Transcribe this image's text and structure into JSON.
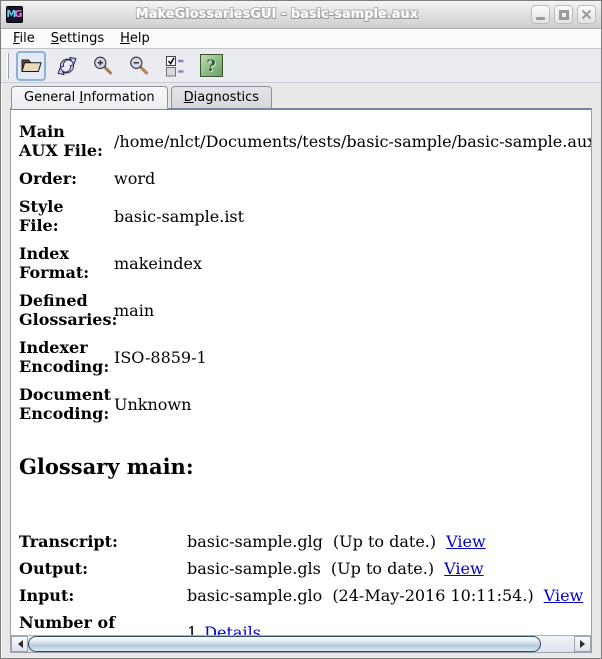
{
  "window": {
    "title": "MakeGlossariesGUI - basic-sample.aux",
    "icon_m": "M",
    "icon_g": "G"
  },
  "menu": {
    "items": [
      {
        "pre": "",
        "key": "F",
        "post": "ile"
      },
      {
        "pre": "",
        "key": "S",
        "post": "ettings"
      },
      {
        "pre": "",
        "key": "H",
        "post": "elp"
      }
    ]
  },
  "toolbar": {
    "icons": [
      "open-file-icon",
      "reload-icon",
      "zoom-in-icon",
      "zoom-out-icon",
      "toggle-options-icon",
      "help-icon"
    ],
    "help_glyph": "?"
  },
  "tabs": [
    {
      "pre": "General ",
      "key": "I",
      "post": "nformation",
      "active": true
    },
    {
      "pre": "",
      "key": "D",
      "post": "iagnostics",
      "active": false
    }
  ],
  "general_info": {
    "rows": [
      {
        "label": "Main AUX File:",
        "value": "/home/nlct/Documents/tests/basic-sample/basic-sample.aux"
      },
      {
        "label": "Order:",
        "value": "word"
      },
      {
        "label": "Style File:",
        "value": "basic-sample.ist"
      },
      {
        "label": "Index Format:",
        "value": "makeindex"
      },
      {
        "label": "Defined Glossaries:",
        "value": "main"
      },
      {
        "label": "Indexer Encoding:",
        "value": "ISO-8859-1"
      },
      {
        "label": "Document Encoding:",
        "value": "Unknown"
      }
    ]
  },
  "glossary": {
    "heading": "Glossary main:",
    "files": [
      {
        "label": "Transcript:",
        "file": "basic-sample.glg",
        "status": "(Up to date.)",
        "link": "View"
      },
      {
        "label": "Output:",
        "file": "basic-sample.gls",
        "status": "(Up to date.)",
        "link": "View"
      },
      {
        "label": "Input:",
        "file": "basic-sample.glo",
        "status": "(24-May-2016 10:11:54.)",
        "link": "View"
      }
    ],
    "entries": {
      "label": "Number of Entries:",
      "value": "1",
      "link": "Details"
    }
  },
  "colors": {
    "link": "#0000cc",
    "tab_underline": "#7387a6",
    "scroll_thumb_border": "#2e4d63",
    "help_button_green": "#8cba84",
    "folder_tan": "#ead9b8",
    "folder_maroon": "#7a4444"
  }
}
